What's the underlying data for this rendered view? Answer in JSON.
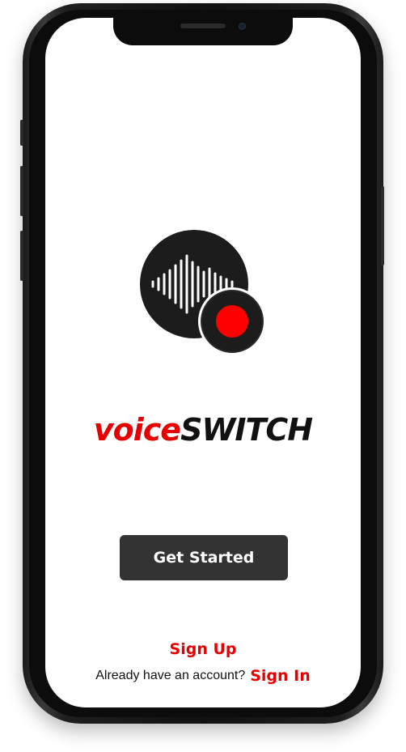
{
  "app": {
    "brand_part1": "voice",
    "brand_part2": "SWITCH",
    "logo_icon": "sound-wave-record-icon"
  },
  "actions": {
    "get_started_label": "Get Started",
    "sign_up_label": "Sign Up",
    "account_prompt": "Already have an account?",
    "sign_in_label": "Sign In"
  },
  "colors": {
    "accent": "#e60000",
    "button_bg": "#333333",
    "logo_bg": "#1c1c1c",
    "background": "#ffffff"
  }
}
